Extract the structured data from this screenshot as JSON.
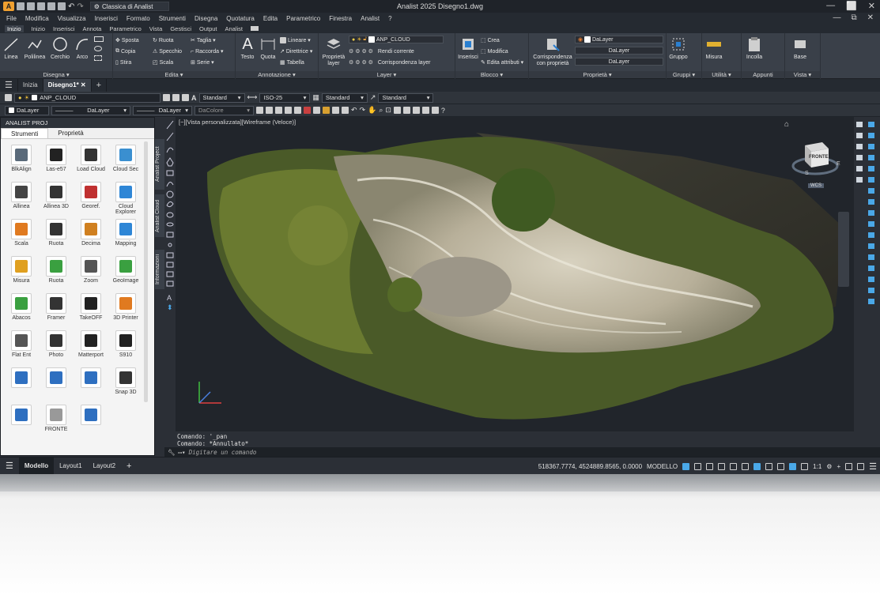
{
  "app": {
    "workspace": "Classica di Analist",
    "title": "Analist 2025   Disegno1.dwg",
    "logo_letter": "A",
    "window_controls": [
      "—",
      "⬜",
      "✕"
    ],
    "doc_controls": [
      "—",
      "⧉",
      "✕"
    ]
  },
  "menu": [
    "File",
    "Modifica",
    "Visualizza",
    "Inserisci",
    "Formato",
    "Strumenti",
    "Disegna",
    "Quotatura",
    "Edita",
    "Parametrico",
    "Finestra",
    "Analist",
    "?"
  ],
  "ribbon_tabs": [
    "Inizio",
    "Inizio",
    "Inserisci",
    "Annota",
    "Parametrico",
    "Vista",
    "Gestisci",
    "Output",
    "Analist"
  ],
  "ribbon": {
    "disegna": {
      "title": "Disegna ▾",
      "big": [
        "Linea",
        "Polilinea",
        "Cerchio",
        "Arco"
      ]
    },
    "edita": {
      "title": "Edita ▾",
      "rows": [
        [
          "Sposta",
          "Ruota",
          "Taglia ▾"
        ],
        [
          "Copia",
          "Specchio",
          "Raccorda ▾"
        ],
        [
          "Stira",
          "Scala",
          "Serie ▾"
        ]
      ]
    },
    "annotazione": {
      "title": "Annotazione ▾",
      "big": [
        "Testo",
        "Quota"
      ],
      "rows": [
        "Lineare ▾",
        "Direttrice ▾",
        "Tabella"
      ]
    },
    "layer": {
      "title": "Layer ▾",
      "big": "Proprietà layer",
      "current": "ANP_CLOUD",
      "rows": [
        "Rendi corrente",
        "Corrispondenza layer"
      ]
    },
    "blocco": {
      "title": "Blocco ▾",
      "big": "Inserisci",
      "rows": [
        "Crea",
        "Modifica",
        "Edita attributi ▾"
      ]
    },
    "proprieta": {
      "title": "Proprietà ▾",
      "big": "Corrispondenza con proprietà",
      "color": "DaLayer",
      "linetype": "DaLayer",
      "lineweight": "DaLayer"
    },
    "gruppi": {
      "title": "Gruppi ▾",
      "big": "Gruppo"
    },
    "utilita": {
      "title": "Utilità ▾",
      "big": "Misura"
    },
    "appunti": {
      "title": "Appunti",
      "big": "Incolla"
    },
    "vista": {
      "title": "Vista ▾",
      "big": "Base"
    }
  },
  "file_tabs": [
    "Inizia",
    "Disegno1*"
  ],
  "toolbar1": {
    "layer": "ANP_CLOUD",
    "textstyle": "Standard",
    "dimstyle": "ISO-25",
    "tablestyle": "Standard",
    "mleaderstyle": "Standard"
  },
  "toolbar2": {
    "color": "DaLayer",
    "linetype": "DaLayer",
    "lineweight": "DaLayer",
    "plotstyle": "DaColore"
  },
  "palette": {
    "header": "ANALIST PROJ",
    "tabs": [
      "Strumenti",
      "Proprietà"
    ],
    "side_tabs": [
      "Analist Project",
      "Analist Cloud",
      "Informazioni"
    ],
    "tools": [
      {
        "label": "BlkAlign",
        "color": "#5a6a7a"
      },
      {
        "label": "Las-e57",
        "color": "#222222"
      },
      {
        "label": "Load Cloud",
        "color": "#333333"
      },
      {
        "label": "Cloud Sec",
        "color": "#3a8fd0"
      },
      {
        "label": "Allinea",
        "color": "#444444"
      },
      {
        "label": "Allinea 3D",
        "color": "#333333"
      },
      {
        "label": "Georef.",
        "color": "#c03030"
      },
      {
        "label": "Cloud Explorer",
        "color": "#2e86d6"
      },
      {
        "label": "Scala",
        "color": "#e07a20"
      },
      {
        "label": "Ruota",
        "color": "#333333"
      },
      {
        "label": "Decima",
        "color": "#d08020"
      },
      {
        "label": "Mapping",
        "color": "#2e86d6"
      },
      {
        "label": "Misura",
        "color": "#e0a020"
      },
      {
        "label": "Ruota",
        "color": "#3aa040"
      },
      {
        "label": "Zoom",
        "color": "#555555"
      },
      {
        "label": "GeoImage",
        "color": "#3aa040"
      },
      {
        "label": "Abacos",
        "color": "#3aa040"
      },
      {
        "label": "Framer",
        "color": "#333333"
      },
      {
        "label": "TakeOFF",
        "color": "#222222"
      },
      {
        "label": "3D Printer",
        "color": "#e07a20"
      },
      {
        "label": "Flat Ent",
        "color": "#555555"
      },
      {
        "label": "Photo",
        "color": "#333333"
      },
      {
        "label": "Matterport",
        "color": "#222222"
      },
      {
        "label": "S910",
        "color": "#222222"
      },
      {
        "label": "",
        "color": "#2e6fc0"
      },
      {
        "label": "",
        "color": "#2e6fc0"
      },
      {
        "label": "",
        "color": "#2e6fc0"
      },
      {
        "label": "Snap 3D",
        "color": "#333333"
      },
      {
        "label": "",
        "color": "#2e6fc0"
      },
      {
        "label": "FRONTE",
        "color": "#999999"
      },
      {
        "label": "",
        "color": "#2e6fc0"
      }
    ]
  },
  "viewport": {
    "label": "[−][Vista personalizzata][Wireframe (Veloce)]",
    "viewcube": "FRONTE",
    "compass": [
      "E",
      "S"
    ],
    "wcs": "WCS"
  },
  "command": {
    "history": [
      "Comando: '_pan",
      "Comando: *Annullato*"
    ],
    "placeholder": "Digitare un comando"
  },
  "status": {
    "tabs": [
      "Modello",
      "Layout1",
      "Layout2"
    ],
    "coords": "518367.7774, 4524889.8565, 0.0000",
    "mode": "MODELLO",
    "scale": "1:1"
  }
}
